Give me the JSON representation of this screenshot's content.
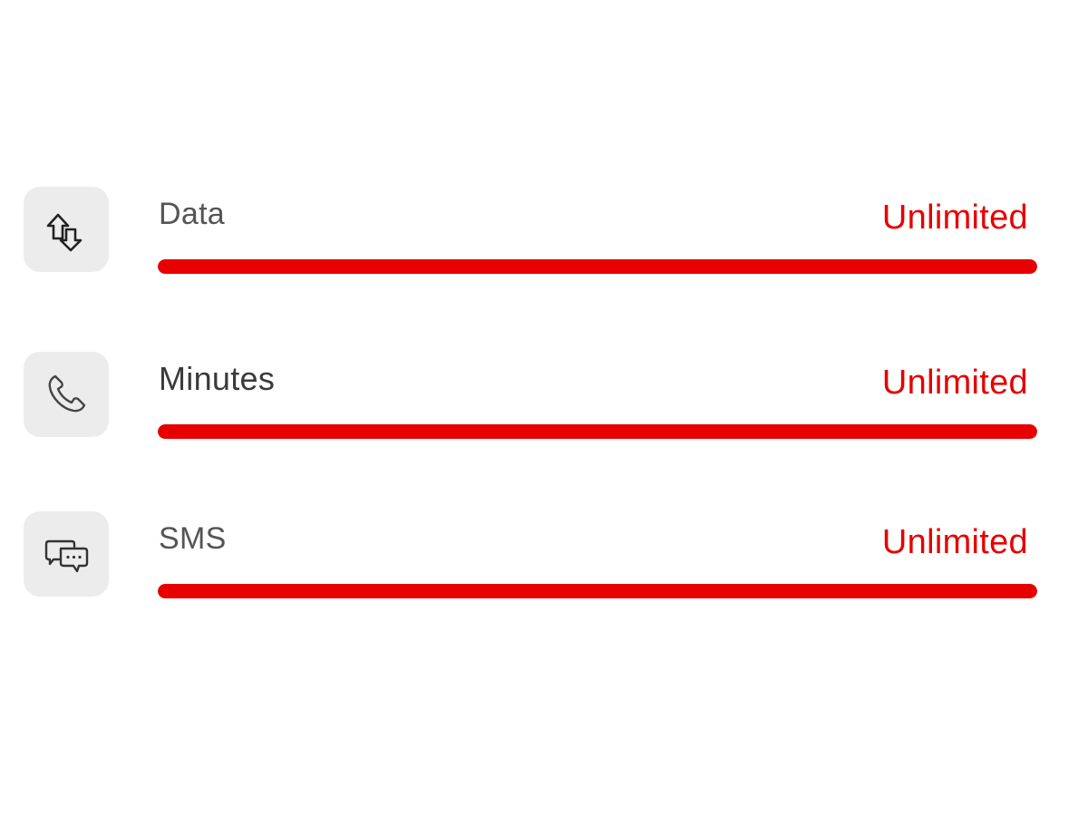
{
  "accent_color": "#e60000",
  "allowances": [
    {
      "icon": "data-transfer-icon",
      "label": "Data",
      "value": "Unlimited",
      "fill_fraction": 1.0
    },
    {
      "icon": "phone-icon",
      "label": "Minutes",
      "value": "Unlimited",
      "fill_fraction": 1.0
    },
    {
      "icon": "chat-bubbles-icon",
      "label": "SMS",
      "value": "Unlimited",
      "fill_fraction": 1.0
    }
  ]
}
